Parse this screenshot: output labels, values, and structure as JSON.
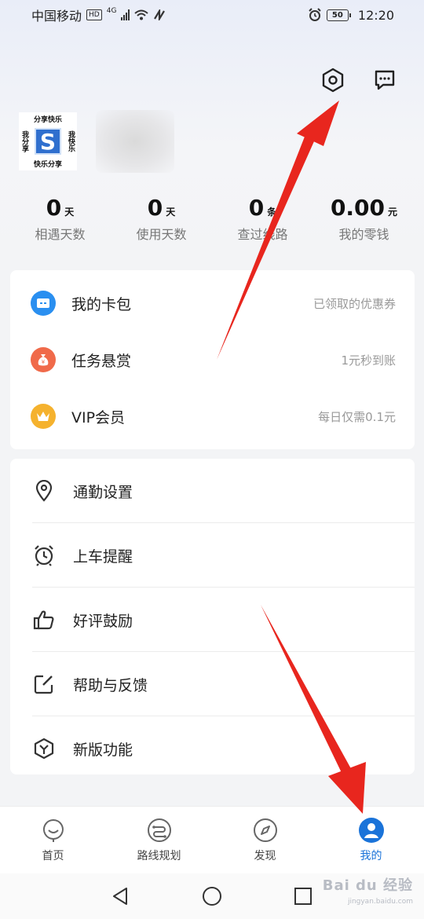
{
  "status_bar": {
    "carrier": "中国移动",
    "hd": "HD",
    "network": "4G",
    "battery": "50",
    "time": "12:20"
  },
  "header": {
    "icons": [
      "settings-hex-icon",
      "message-icon"
    ]
  },
  "profile": {
    "logo_text_top": "分享快乐",
    "logo_text_bottom": "快乐分享",
    "logo_text_left": "我分享",
    "logo_text_right": "我快乐",
    "logo_letter": "S"
  },
  "stats": [
    {
      "value": "0",
      "unit": "天",
      "label": "相遇天数"
    },
    {
      "value": "0",
      "unit": "天",
      "label": "使用天数"
    },
    {
      "value": "0",
      "unit": "条",
      "label": "查过线路"
    },
    {
      "value": "0.00",
      "unit": "元",
      "label": "我的零钱"
    }
  ],
  "card1": [
    {
      "label": "我的卡包",
      "right": "已领取的优惠券",
      "icon": "card-wallet-icon",
      "color": "#2a8ff0"
    },
    {
      "label": "任务悬赏",
      "right": "1元秒到账",
      "icon": "money-bag-icon",
      "color": "#f06a4a"
    },
    {
      "label": "VIP会员",
      "right": "每日仅需0.1元",
      "icon": "crown-icon",
      "color": "#f5b22e"
    }
  ],
  "card2": [
    {
      "label": "通勤设置",
      "icon": "location-pin-icon"
    },
    {
      "label": "上车提醒",
      "icon": "alarm-clock-icon"
    },
    {
      "label": "好评鼓励",
      "icon": "thumbs-up-icon"
    },
    {
      "label": "帮助与反馈",
      "icon": "edit-feedback-icon"
    },
    {
      "label": "新版功能",
      "icon": "new-feature-icon"
    }
  ],
  "tabs": [
    {
      "label": "首页",
      "icon": "home-smile-icon",
      "active": false
    },
    {
      "label": "路线规划",
      "icon": "route-icon",
      "active": false
    },
    {
      "label": "发现",
      "icon": "compass-icon",
      "active": false
    },
    {
      "label": "我的",
      "icon": "profile-icon",
      "active": true
    }
  ],
  "colors": {
    "accent": "#1a73d9",
    "annotation_arrow": "#e8261e"
  },
  "watermark": {
    "main": "Bai du 经验",
    "sub": "jingyan.baidu.com"
  }
}
